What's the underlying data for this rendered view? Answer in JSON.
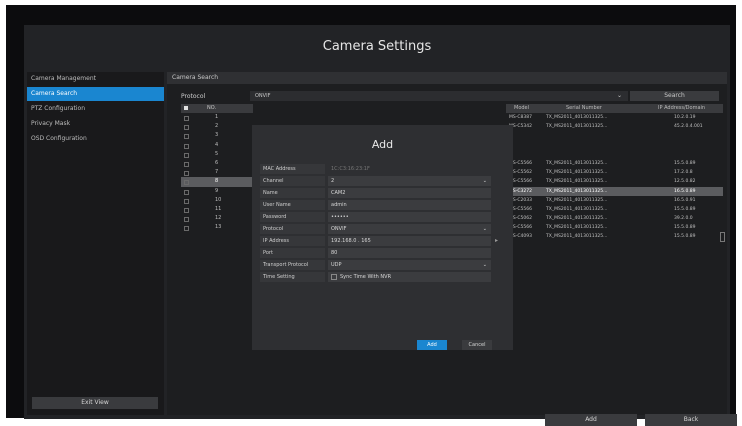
{
  "window": {
    "title": "Camera Settings"
  },
  "sidebar": {
    "items": [
      {
        "label": "Camera Management"
      },
      {
        "label": "Camera Search"
      },
      {
        "label": "PTZ Configuration"
      },
      {
        "label": "Privacy Mask"
      },
      {
        "label": "OSD Configuration"
      }
    ],
    "exit_label": "Exit View"
  },
  "main": {
    "section_title": "Camera Search",
    "protocol_label": "Protocol",
    "protocol_value": "ONVIF",
    "search_label": "Search",
    "left_table": {
      "header_no": "NO.",
      "rows": [
        "1",
        "2",
        "3",
        "4",
        "5",
        "6",
        "7",
        "8",
        "9",
        "10",
        "11",
        "12",
        "13"
      ]
    },
    "right_table": {
      "headers": [
        "Model",
        "Serial Number",
        "IP Address/Domain"
      ],
      "rows": [
        [
          "MS-C8387",
          "TX_MS2011_4013011325...",
          "10.2.0.19"
        ],
        [
          "MS-C5342",
          "TX_MS2011_4013011325...",
          "45.2.0.4.001"
        ],
        [
          "",
          "",
          ""
        ],
        [
          "",
          "",
          ""
        ],
        [
          "",
          "",
          ""
        ],
        [
          "MS-C5566",
          "TX_MS2011_4013011325...",
          "15.5.0.89"
        ],
        [
          "MS-C5562",
          "TX_MS2011_4013011325...",
          "17.2.0.8"
        ],
        [
          "MS-C5566",
          "TX_MS2011_4013011325...",
          "12.5.0.82"
        ],
        [
          "MS-C3272",
          "TX_MS2011_4013011325...",
          "16.5.0.89"
        ],
        [
          "MS-C2033",
          "TX_MS2011_4013011325...",
          "16.5.0.91"
        ],
        [
          "MS-C5566",
          "TX_MS2011_4013011325...",
          "15.5.0.89"
        ],
        [
          "MS-C5062",
          "TX_MS2011_4013011325...",
          "39.2.0.0"
        ],
        [
          "MS-C5566",
          "TX_MS2011_4013011325...",
          "15.5.0.89"
        ],
        [
          "MS-C4093",
          "TX_MS2011_4013011325...",
          "15.5.0.89"
        ]
      ]
    },
    "add_label": "Add",
    "back_label": "Back"
  },
  "modal": {
    "title": "Add",
    "fields": [
      {
        "label": "MAC Address",
        "value": "1C:C3:16:23:1F"
      },
      {
        "label": "Channel",
        "value": "2"
      },
      {
        "label": "Name",
        "value": "CAM2"
      },
      {
        "label": "User Name",
        "value": "admin"
      },
      {
        "label": "Password",
        "value": "••••••"
      },
      {
        "label": "Protocol",
        "value": "ONVIF"
      },
      {
        "label": "IP Address",
        "value": "192.168.0 . 165"
      },
      {
        "label": "Port",
        "value": "80"
      },
      {
        "label": "Transport Protocol",
        "value": "UDP"
      },
      {
        "label": "Time Setting",
        "value": "Sync Time With NVR"
      }
    ],
    "apply_label": "Add",
    "cancel_label": "Cancel"
  }
}
